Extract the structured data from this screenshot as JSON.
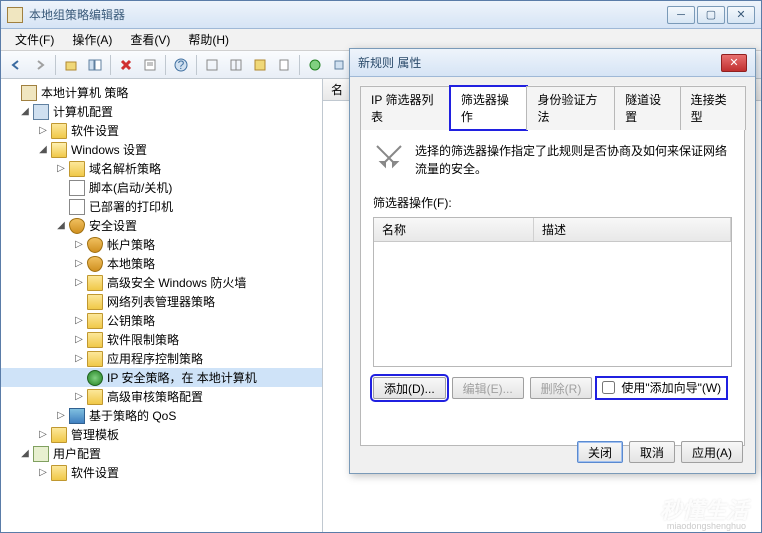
{
  "window": {
    "title": "本地组策略编辑器"
  },
  "menu": {
    "file": "文件(F)",
    "action": "操作(A)",
    "view": "查看(V)",
    "help": "帮助(H)"
  },
  "tree": {
    "root": "本地计算机 策略",
    "computer_config": "计算机配置",
    "software_settings": "软件设置",
    "windows_settings": "Windows 设置",
    "dns_policy": "域名解析策略",
    "scripts": "脚本(启动/关机)",
    "deployed_printers": "已部署的打印机",
    "security_settings": "安全设置",
    "account_policy": "帐户策略",
    "local_policy": "本地策略",
    "adv_firewall": "高级安全 Windows 防火墙",
    "net_list_mgr": "网络列表管理器策略",
    "public_key": "公钥策略",
    "software_restrict": "软件限制策略",
    "app_control": "应用程序控制策略",
    "ip_security": "IP 安全策略，在 本地计算机",
    "adv_audit": "高级审核策略配置",
    "policy_qos": "基于策略的 QoS",
    "admin_templates": "管理模板",
    "user_config": "用户配置",
    "user_software": "软件设置"
  },
  "list": {
    "header_name": "名"
  },
  "dialog": {
    "title": "新规则 属性",
    "tabs": {
      "ip_filter": "IP 筛选器列表",
      "filter_action": "筛选器操作",
      "auth": "身份验证方法",
      "tunnel": "隧道设置",
      "conn_type": "连接类型"
    },
    "info": "选择的筛选器操作指定了此规则是否协商及如何来保证网络流量的安全。",
    "group_label": "筛选器操作(F):",
    "col_name": "名称",
    "col_desc": "描述",
    "btn_add": "添加(D)...",
    "btn_edit": "编辑(E)...",
    "btn_remove": "删除(R)",
    "check_wizard": "使用\"添加向导\"(W)",
    "btn_close": "关闭",
    "btn_cancel": "取消",
    "btn_apply": "应用(A)"
  },
  "watermark": "秒懂生活",
  "watermark_sub": "miaodongshenghuo"
}
